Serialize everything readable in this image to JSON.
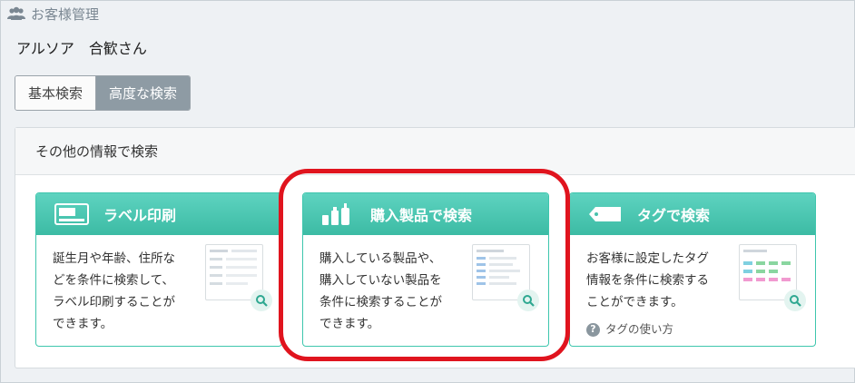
{
  "header": {
    "title": "お客様管理",
    "icon": "users-icon"
  },
  "customer": {
    "store": "アルソア",
    "name": "合歓さん"
  },
  "search_tabs": {
    "basic": "基本検索",
    "advanced": "高度な検索",
    "active": "advanced"
  },
  "panel": {
    "title": "その他の情報で検索"
  },
  "cards": [
    {
      "title": "ラベル印刷",
      "icon": "label-card-icon",
      "desc": [
        "誕生月や年齢、住所な",
        "どを条件に検索して、",
        "ラベル印刷することが",
        "できます。"
      ]
    },
    {
      "title": "購入製品で検索",
      "icon": "products-bottles-icon",
      "desc": [
        "購入している製品や、",
        "購入していない製品を",
        "条件に検索することが",
        "できます。"
      ]
    },
    {
      "title": "タグで検索",
      "icon": "tag-icon",
      "desc": [
        "お客様に設定したタグ",
        "情報を条件に検索する",
        "ことができます。"
      ],
      "help": "タグの使い方"
    }
  ],
  "colors": {
    "accent": "#3ec6ad",
    "highlight": "#e0141e",
    "active_tab": "#8e9ba4"
  }
}
